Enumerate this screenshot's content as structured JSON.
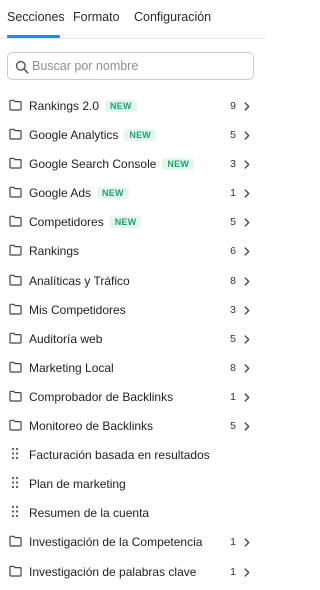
{
  "tabs": [
    {
      "label": "Secciones",
      "active": true
    },
    {
      "label": "Formato",
      "active": false
    },
    {
      "label": "Configuración",
      "active": false
    }
  ],
  "search": {
    "placeholder": "Buscar por nombre",
    "value": "",
    "icon": "search-icon"
  },
  "colors": {
    "accent": "#1a8df0",
    "badge_text": "#19a66a",
    "badge_bg": "#e4f6ee"
  },
  "sections": [
    {
      "label": "Rankings 2.0",
      "badge": "NEW",
      "count": "9",
      "icon": "folder-icon"
    },
    {
      "label": "Google Analytics",
      "badge": "NEW",
      "count": "5",
      "icon": "folder-icon"
    },
    {
      "label": "Google Search Console",
      "badge": "NEW",
      "count": "3",
      "icon": "folder-icon"
    },
    {
      "label": "Google Ads",
      "badge": "NEW",
      "count": "1",
      "icon": "folder-icon"
    },
    {
      "label": "Competidores",
      "badge": "NEW",
      "count": "5",
      "icon": "folder-icon"
    },
    {
      "label": "Rankings",
      "badge": "",
      "count": "6",
      "icon": "folder-icon"
    },
    {
      "label": "Analíticas y Tráfico",
      "badge": "",
      "count": "8",
      "icon": "folder-icon"
    },
    {
      "label": "Mis Competidores",
      "badge": "",
      "count": "3",
      "icon": "folder-icon"
    },
    {
      "label": "Auditoría web",
      "badge": "",
      "count": "5",
      "icon": "folder-icon"
    },
    {
      "label": "Marketing Local",
      "badge": "",
      "count": "8",
      "icon": "folder-icon"
    },
    {
      "label": "Comprobador de Backlinks",
      "badge": "",
      "count": "1",
      "icon": "folder-icon"
    },
    {
      "label": "Monitoreo de Backlinks",
      "badge": "",
      "count": "5",
      "icon": "folder-icon"
    },
    {
      "label": "Facturación basada en resultados",
      "badge": "",
      "count": "",
      "icon": "drag-handle-icon"
    },
    {
      "label": "Plan de marketing",
      "badge": "",
      "count": "",
      "icon": "drag-handle-icon"
    },
    {
      "label": "Resumen de la cuenta",
      "badge": "",
      "count": "",
      "icon": "drag-handle-icon"
    },
    {
      "label": "Investigación de la Competencia",
      "badge": "",
      "count": "1",
      "icon": "folder-icon"
    },
    {
      "label": "Investigación de palabras clave",
      "badge": "",
      "count": "1",
      "icon": "folder-icon"
    }
  ]
}
